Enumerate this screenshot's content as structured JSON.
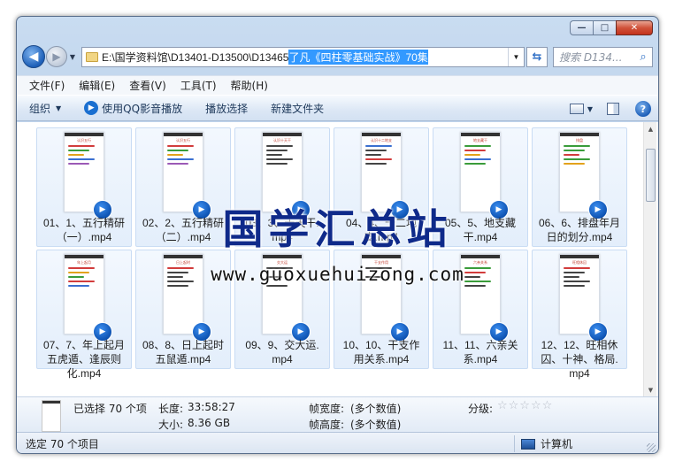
{
  "window": {
    "caption_min": "—",
    "caption_max": "□",
    "caption_close": "✕"
  },
  "nav": {
    "back_glyph": "◀",
    "fwd_glyph": "▶",
    "address_path": "E:\\国学资料馆\\D13401-D13500\\D13465 ",
    "address_selected": "了凡《四柱零基础实战》70集",
    "search_placeholder": "搜索 D134...",
    "refresh_glyph": "⇆"
  },
  "menu": [
    "文件(F)",
    "编辑(E)",
    "查看(V)",
    "工具(T)",
    "帮助(H)"
  ],
  "commands": {
    "organize": "组织",
    "play_qq": "使用QQ影音播放",
    "play_select": "播放选择",
    "new_folder": "新建文件夹",
    "help_glyph": "?"
  },
  "files": [
    {
      "line1": "01、1、五行精研",
      "line2": "（一）.mp4",
      "title": "认识五行",
      "colors": [
        "#d23c3c",
        "#3a9c3a",
        "#e3a21a",
        "#3a6fd0",
        "#9b59b6"
      ]
    },
    {
      "line1": "02、2、五行精研",
      "line2": "（二）.mp4",
      "title": "认识五行",
      "colors": [
        "#d23c3c",
        "#3a9c3a",
        "#e3a21a",
        "#3a6fd0",
        "#9b59b6"
      ]
    },
    {
      "line1": "03、3、十天干.",
      "line2": "mp4",
      "title": "认识十天干",
      "colors": [
        "#444444",
        "#444444",
        "#444444",
        "#444444",
        "#444444"
      ]
    },
    {
      "line1": "04、4、十二地",
      "line2": "支.mp4",
      "title": "认识十二地支",
      "colors": [
        "#3a6fd0",
        "#444444",
        "#444444",
        "#d23c3c",
        "#444444"
      ]
    },
    {
      "line1": "05、5、地支藏",
      "line2": "干.mp4",
      "title": "地支藏干",
      "colors": [
        "#3a9c3a",
        "#d23c3c",
        "#e3a21a",
        "#3a6fd0",
        "#3a9c3a"
      ]
    },
    {
      "line1": "06、6、排盘年月",
      "line2": "日的划分.mp4",
      "title": "排盘",
      "colors": [
        "#3a9c3a",
        "#3a9c3a",
        "#d23c3c",
        "#3a9c3a",
        "#e3a21a"
      ]
    },
    {
      "line1": "07、7、年上起月",
      "line2": "五虎遁、逢辰则",
      "line3": "化.mp4",
      "title": "年上起月",
      "colors": [
        "#d23c3c",
        "#e3a21a",
        "#3a9c3a",
        "#d23c3c",
        "#3a6fd0"
      ]
    },
    {
      "line1": "08、8、日上起时",
      "line2": "五鼠遁.mp4",
      "title": "日上起时",
      "colors": [
        "#d23c3c",
        "#444444",
        "#444444",
        "#444444",
        "#444444"
      ]
    },
    {
      "line1": "09、9、交大运.",
      "line2": "mp4",
      "title": "交大运",
      "colors": [
        "#444444",
        "#ffffff",
        "#444444",
        "#ffffff",
        "#444444"
      ]
    },
    {
      "line1": "10、10、干支作",
      "line2": "用关系.mp4",
      "title": "干支作用",
      "colors": [
        "#444444",
        "#ffffff",
        "#444444",
        "#ffffff",
        "#ffffff"
      ]
    },
    {
      "line1": "11、11、六亲关",
      "line2": "系.mp4",
      "title": "六亲关系",
      "colors": [
        "#3a9c3a",
        "#d23c3c",
        "#444444",
        "#3a9c3a",
        "#444444"
      ]
    },
    {
      "line1": "12、12、旺相休",
      "line2": "囚、十神、格局.",
      "line3": "mp4",
      "title": "旺相休囚",
      "colors": [
        "#d23c3c",
        "#444444",
        "#444444",
        "#444444",
        "#444444"
      ]
    }
  ],
  "watermark": {
    "title": "国学汇总站",
    "url": "www.guoxuehuizong.com"
  },
  "details": {
    "selected": "已选择 70 个项",
    "length_label": "长度:",
    "length_value": "33:58:27",
    "size_label": "大小:",
    "size_value": "8.36 GB",
    "frame_width_label": "帧宽度:",
    "frame_width_value": "(多个数值)",
    "frame_height_label": "帧高度:",
    "frame_height_value": "(多个数值)",
    "rating_label": "分级:",
    "rating_stars": "☆☆☆☆☆"
  },
  "status": {
    "selected_text": "选定 70 个项目",
    "location": "计算机"
  }
}
